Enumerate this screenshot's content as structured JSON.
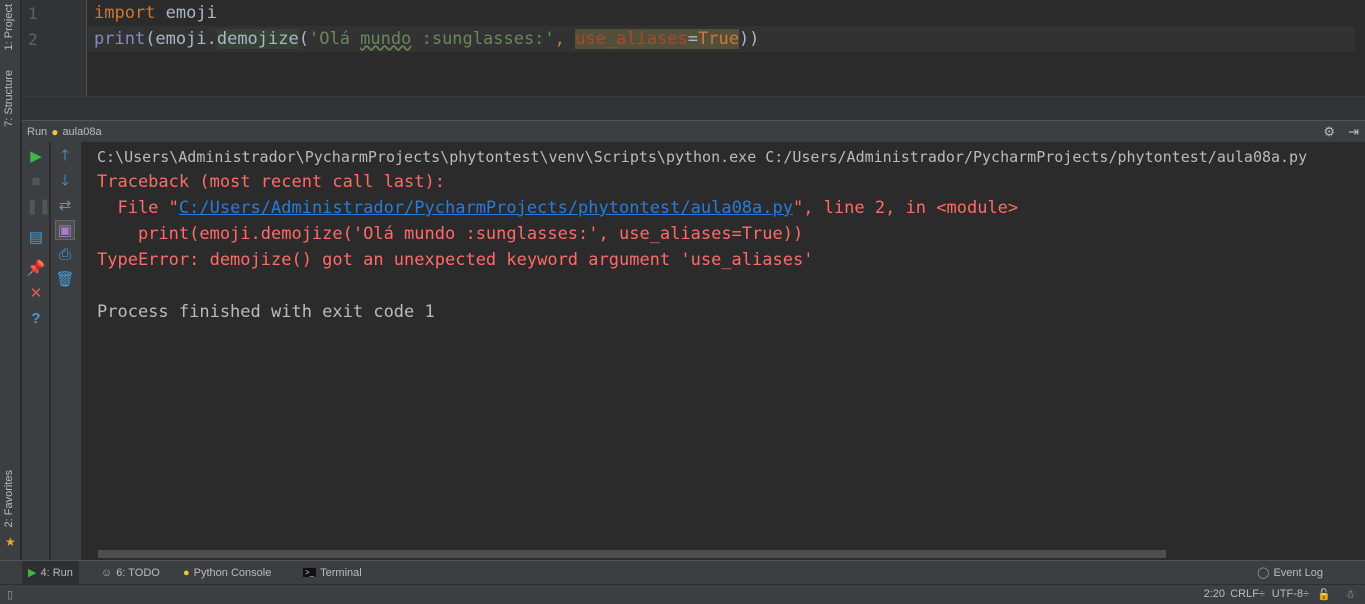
{
  "left_strip": {
    "project": "1: Project",
    "structure": "7: Structure",
    "favorites": "2: Favorites"
  },
  "editor": {
    "line_numbers": [
      "1",
      "2"
    ],
    "line1": {
      "kw": "import",
      "rest": " emoji"
    },
    "line2": {
      "fn": "print",
      "p1": "(emoji.",
      "call": "demojize",
      "p2": "(",
      "s1": "'Olá ",
      "s2": "mundo",
      "s3": " :sunglasses:'",
      ", ": ", ",
      "kwarg": "use_aliases",
      "eq": "=",
      "val": "True",
      "end": "))"
    }
  },
  "run": {
    "label": "Run",
    "config": "aula08a"
  },
  "console": {
    "cmd": "C:\\Users\\Administrador\\PycharmProjects\\phytontest\\venv\\Scripts\\python.exe C:/Users/Administrador/PycharmProjects/phytontest/aula08a.py",
    "tb": "Traceback (most recent call last):",
    "file_pre": "  File \"",
    "file_link": "C:/Users/Administrador/PycharmProjects/phytontest/aula08a.py",
    "file_post": "\", line 2, in <module>",
    "src": "    print(emoji.demojize('Olá mundo :sunglasses:', use_aliases=True))",
    "err": "TypeError: demojize() got an unexpected keyword argument 'use_aliases'",
    "exit": "Process finished with exit code 1"
  },
  "tabs": {
    "run": "4: Run",
    "todo": "6: TODO",
    "pyconsole": "Python Console",
    "terminal": "Terminal",
    "eventlog": "Event Log"
  },
  "status": {
    "pos": "2:20",
    "sep": "CRLF÷",
    "enc": "UTF-8÷"
  }
}
